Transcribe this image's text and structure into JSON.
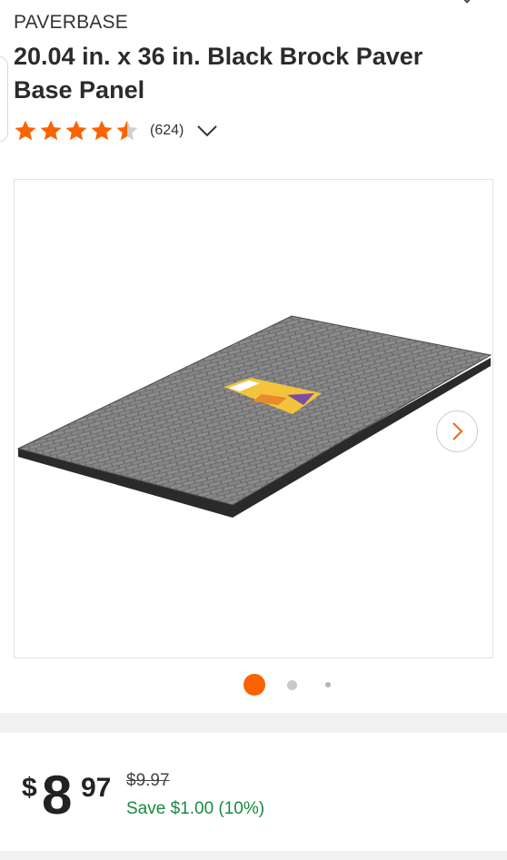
{
  "product": {
    "brand": "PAVERBASE",
    "title": "20.04 in. x 36 in. Black Brock Paver Base Panel",
    "rating": 4.5,
    "review_count": "(624)",
    "icons": {
      "star_full": "star-icon",
      "star_half": "star-half-icon",
      "reviews_toggle": "chevron-down-icon",
      "gallery_next": "chevron-right-icon"
    }
  },
  "gallery": {
    "image_label": "Black Brock Paver Base Panel",
    "current_index": 1,
    "total_images": 3
  },
  "pricing": {
    "currency_symbol": "$",
    "price_whole": "8",
    "price_cents": "97",
    "original_price": "$9.97",
    "savings": "Save $1.00 (10%)"
  },
  "colors": {
    "accent": "#f96302",
    "savings_green": "#1a8a3e",
    "star": "#f96302"
  }
}
